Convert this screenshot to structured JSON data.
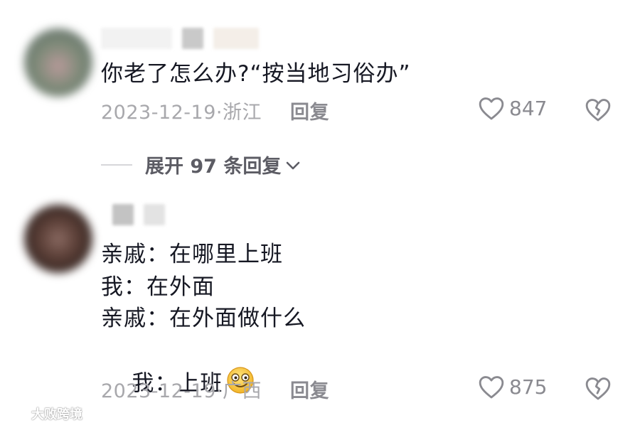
{
  "comments": [
    {
      "text": "你老了怎么办?“按当地习俗办”",
      "meta": "2023-12-19·浙江",
      "reply_label": "回复",
      "likes": "847"
    },
    {
      "lines": [
        "亲戚：在哪里上班",
        "我：在外面",
        "亲戚：在外面做什么",
        "我：上班"
      ],
      "meta": "2023-12-19·广西",
      "reply_label": "回复",
      "likes": "875"
    }
  ],
  "expand_replies": "展开 97 条回复",
  "watermark": "大败跨境",
  "colors": {
    "text": "#161823",
    "meta": "#a8a8ac",
    "icon": "#8a8a90"
  }
}
